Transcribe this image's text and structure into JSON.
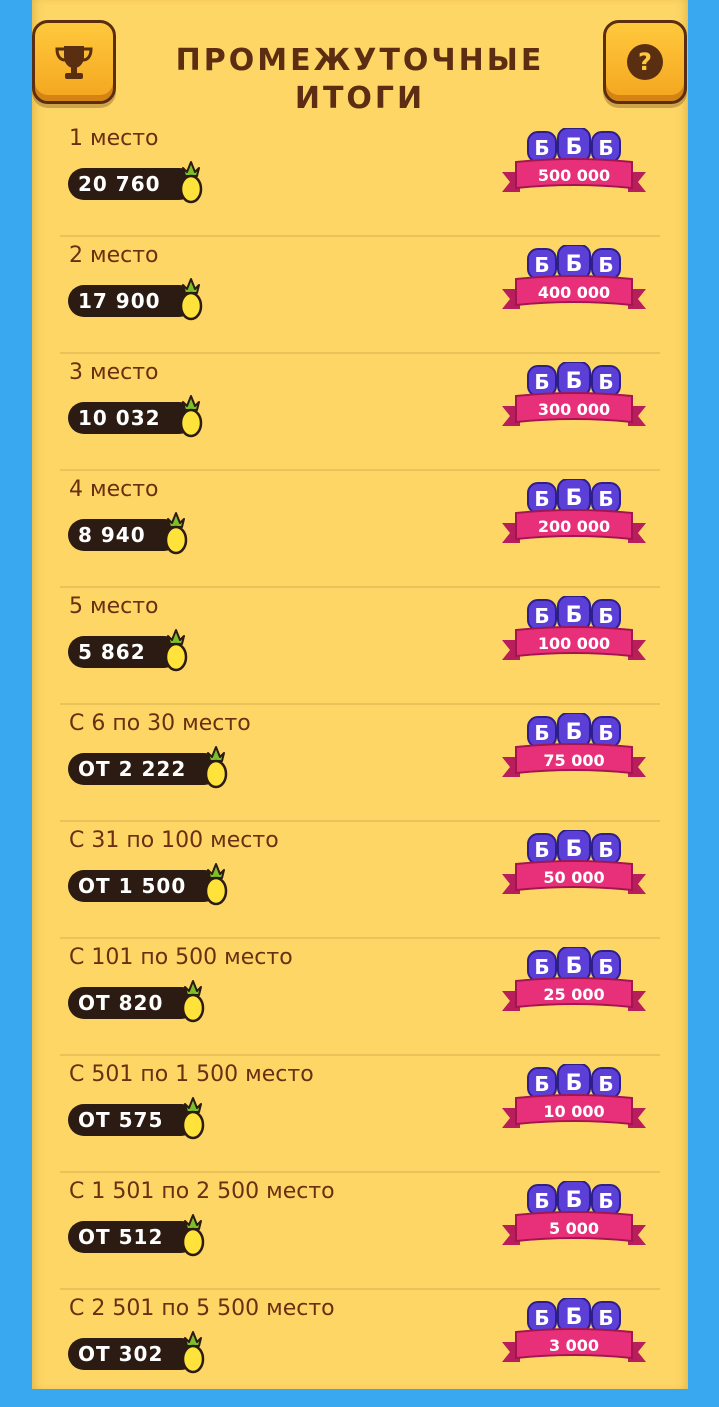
{
  "title": "ПРОМЕЖУТОЧНЫЕ ИТОГИ",
  "header": {
    "left_icon": "trophy-icon",
    "right_icon": "question-icon",
    "help_label": "?"
  },
  "reward_letters": [
    "Б",
    "Б",
    "Б"
  ],
  "rows": [
    {
      "place": "1 место",
      "score": "20 760",
      "reward": "500 000"
    },
    {
      "place": "2 место",
      "score": "17 900",
      "reward": "400 000"
    },
    {
      "place": "3 место",
      "score": "10 032",
      "reward": "300 000"
    },
    {
      "place": "4 место",
      "score": "8 940",
      "reward": "200 000"
    },
    {
      "place": "5 место",
      "score": "5 862",
      "reward": "100 000"
    },
    {
      "place": "С 6 по 30 место",
      "score": "ОТ 2 222",
      "reward": "75 000"
    },
    {
      "place": "С 31 по 100 место",
      "score": "ОТ 1 500",
      "reward": "50 000"
    },
    {
      "place": "С 101 по 500 место",
      "score": "ОТ 820",
      "reward": "25 000"
    },
    {
      "place": "С 501 по 1 500 место",
      "score": "ОТ 575",
      "reward": "10 000"
    },
    {
      "place": "С 1 501 по 2 500 место",
      "score": "ОТ 512",
      "reward": "5 000"
    },
    {
      "place": "С 2 501 по 5 500 место",
      "score": "ОТ 302",
      "reward": "3 000"
    }
  ],
  "colors": {
    "background": "#3aa8f0",
    "panel": "#fdd666",
    "title": "#5c2d12",
    "pill": "#2b1b12",
    "ribbon": "#e8307a",
    "badge": "#5b3fd6"
  }
}
